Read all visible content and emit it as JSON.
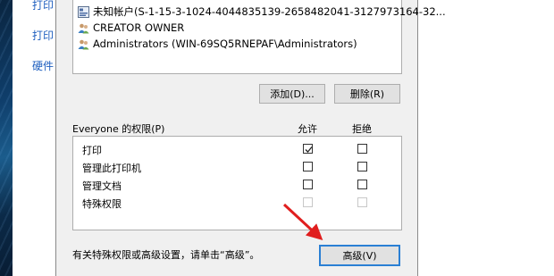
{
  "background_window": {
    "items": [
      "打印",
      "打印",
      "硬件"
    ]
  },
  "users_list": [
    {
      "icon": "unknown-account-icon",
      "label": "未知帐户(S-1-15-3-1024-4044835139-2658482041-3127973164-32..."
    },
    {
      "icon": "user-group-icon",
      "label": "CREATOR OWNER"
    },
    {
      "icon": "user-group-icon",
      "label": "Administrators (WIN-69SQ5RNEPAF\\Administrators)"
    }
  ],
  "buttons": {
    "add": "添加(D)...",
    "remove": "删除(R)",
    "advanced": "高级(V)"
  },
  "permissions": {
    "title": "Everyone 的权限(P)",
    "allow_header": "允许",
    "deny_header": "拒绝",
    "rows": [
      {
        "name": "打印",
        "allow": true,
        "deny": false,
        "disabled": false
      },
      {
        "name": "管理此打印机",
        "allow": false,
        "deny": false,
        "disabled": false
      },
      {
        "name": "管理文档",
        "allow": false,
        "deny": false,
        "disabled": false
      },
      {
        "name": "特殊权限",
        "allow": false,
        "deny": false,
        "disabled": true
      }
    ]
  },
  "footer_text": "有关特殊权限或高级设置，请单击“高级”。",
  "colors": {
    "accent": "#2a7fd4",
    "arrow": "#e01e1e",
    "link": "#1f5fbf"
  }
}
